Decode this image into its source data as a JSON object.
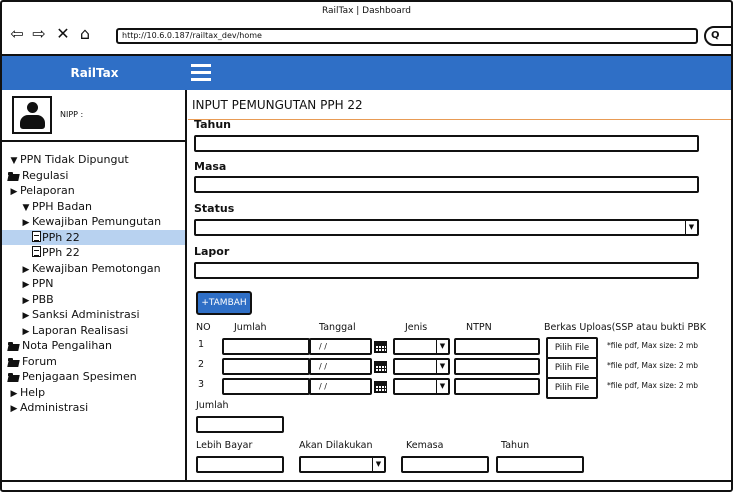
{
  "browser": {
    "window_title": "RailTax | Dashboard",
    "url": "http://10.6.0.187/railtax_dev/home",
    "search_label": "Q"
  },
  "app": {
    "brand": "RailTax",
    "colors": {
      "header": "#2f6fc6",
      "selected_item": "#b8d2f0",
      "title_underline": "#e89b55"
    }
  },
  "sidebar": {
    "nipp_label": "NIPP :",
    "items": [
      {
        "label": "PPN Tidak Dipungut",
        "glyph": "▼",
        "type": "caret",
        "indent": 0
      },
      {
        "label": "Regulasi",
        "glyph": "",
        "type": "folder",
        "indent": 0
      },
      {
        "label": "Pelaporan",
        "glyph": "▶",
        "type": "caret",
        "indent": 0
      },
      {
        "label": "PPH Badan",
        "glyph": "▼",
        "type": "caret",
        "indent": 1
      },
      {
        "label": "Kewajiban Pemungutan",
        "glyph": "▶",
        "type": "caret",
        "indent": 1
      },
      {
        "label": "PPh 22",
        "glyph": "",
        "type": "file",
        "indent": 2,
        "selected": true
      },
      {
        "label": "PPh 22",
        "glyph": "",
        "type": "file",
        "indent": 2
      },
      {
        "label": "Kewajiban Pemotongan",
        "glyph": "▶",
        "type": "caret",
        "indent": 1
      },
      {
        "label": "PPN",
        "glyph": "▶",
        "type": "caret",
        "indent": 1
      },
      {
        "label": "PBB",
        "glyph": "▶",
        "type": "caret",
        "indent": 1
      },
      {
        "label": "Sanksi Administrasi",
        "glyph": "▶",
        "type": "caret",
        "indent": 1
      },
      {
        "label": "Laporan Realisasi",
        "glyph": "▶",
        "type": "caret",
        "indent": 1
      },
      {
        "label": "Nota Pengalihan",
        "glyph": "",
        "type": "folder",
        "indent": 0
      },
      {
        "label": "Forum",
        "glyph": "",
        "type": "folder",
        "indent": 0
      },
      {
        "label": "Penjagaan Spesimen",
        "glyph": "",
        "type": "folder",
        "indent": 0
      },
      {
        "label": "Help",
        "glyph": "▶",
        "type": "caret",
        "indent": 0
      },
      {
        "label": "Administrasi",
        "glyph": "▶",
        "type": "caret",
        "indent": 0
      }
    ]
  },
  "form": {
    "title": "INPUT PEMUNGUTAN PPH 22",
    "tahun_label": "Tahun",
    "masa_label": "Masa",
    "status_label": "Status",
    "lapor_label": "Lapor",
    "add_button": "+TAMBAH",
    "table": {
      "headers": {
        "no": "NO",
        "jumlah": "Jumlah",
        "tanggal": "Tanggal",
        "jenis": "Jenis",
        "ntpn": "NTPN",
        "berkas": "Berkas Uploas(SSP atau bukti PBK"
      },
      "rows": [
        {
          "no": "1",
          "date_placeholder": "/ /",
          "file_button": "Pilih File",
          "note": "*file pdf, Max size: 2 mb"
        },
        {
          "no": "2",
          "date_placeholder": "/ /",
          "file_button": "Pilih File",
          "note": "*file pdf, Max size: 2 mb"
        },
        {
          "no": "3",
          "date_placeholder": "/ /",
          "file_button": "Pilih File",
          "note": "*file pdf, Max size: 2 mb"
        }
      ]
    },
    "jumlah_label": "Jumlah",
    "lebih_bayar_label": "Lebih Bayar",
    "akan_dilakukan_label": "Akan Dilakukan",
    "kemasa_label": "Kemasa",
    "tahun2_label": "Tahun"
  }
}
